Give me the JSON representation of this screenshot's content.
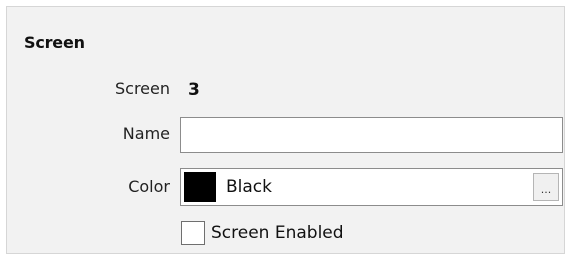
{
  "section": {
    "title": "Screen"
  },
  "fields": {
    "screen_label": "Screen",
    "screen_value": "3",
    "name_label": "Name",
    "name_value": "",
    "color_label": "Color",
    "color_value": "Black",
    "color_swatch": "#000000",
    "browse_label": "..."
  },
  "options": {
    "screen_enabled_label": "Screen Enabled",
    "screen_enabled_checked": false
  }
}
